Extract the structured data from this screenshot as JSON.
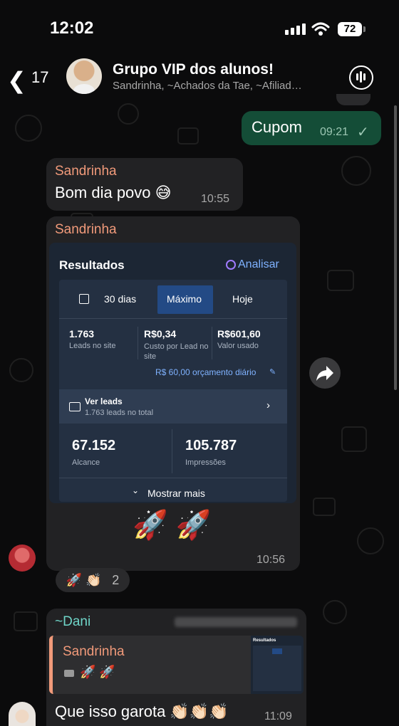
{
  "status": {
    "time": "12:02",
    "battery": "72"
  },
  "header": {
    "back_count": "17",
    "title": "Grupo VIP dos alunos!",
    "subtitle": "Sandrinha, ~Achados da Tae, ~Afiliad…"
  },
  "messages": {
    "cupom": {
      "text": "Cupom",
      "time": "09:21",
      "check": "✓"
    },
    "bomdia": {
      "sender": "Sandrinha",
      "text": "Bom dia povo 😅",
      "time": "10:55"
    },
    "image_msg": {
      "sender": "Sandrinha",
      "time": "10:56",
      "caption": "🚀 🚀",
      "shot": {
        "title": "Resultados",
        "analyze": "Analisar",
        "tabs": [
          "30 dias",
          "Máximo",
          "Hoje"
        ],
        "metrics": [
          {
            "value": "1.763",
            "label": "Leads no site"
          },
          {
            "value": "R$0,34",
            "label": "Custo por Lead no site"
          },
          {
            "value": "R$601,60",
            "label": "Valor usado"
          }
        ],
        "budget": "R$ 60,00 orçamento diário",
        "leads_title": "Ver leads",
        "leads_sub": "1.763 leads no total",
        "reach_value": "67.152",
        "reach_label": "Alcance",
        "impr_value": "105.787",
        "impr_label": "Impressões",
        "more": "Mostrar mais"
      }
    },
    "reactions": {
      "emojis": "🚀 👏🏻",
      "count": "2"
    },
    "dani": {
      "sender": "~Dani",
      "quote_sender": "Sandrinha",
      "quote_text": "🚀 🚀",
      "text": "Que isso garota 👏🏻👏🏻👏🏻",
      "time": "11:09",
      "thumb_title": "Resultados"
    }
  },
  "colors": {
    "outgoing": "#144d37",
    "incoming": "#222224",
    "sandrinha": "#f19a7a",
    "dani": "#6fd5c8",
    "accent_blue": "#7fb2ff"
  }
}
